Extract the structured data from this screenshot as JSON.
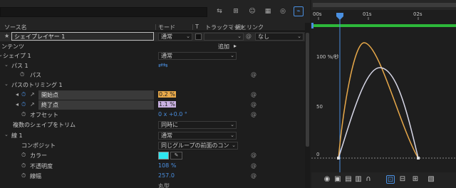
{
  "header": {
    "col_source": "ソース名",
    "col_mode": "モード",
    "col_t": "T",
    "col_trackmatte": "トラックマット",
    "col_parent": "親とリンク"
  },
  "layer": {
    "star": "★",
    "name": "シェイプレイヤー 1",
    "mode": "通常",
    "parent": "なし"
  },
  "rows": {
    "contents": "ンテンツ",
    "add_label": "追加",
    "shape1": "シェイプ 1",
    "shape1_mode": "通常",
    "path1": "パス 1",
    "path": "パス",
    "trim": "パスのトリミング 1",
    "start": "開始点",
    "start_val": "0.2 %",
    "end": "終了点",
    "end_val": "1.1 %",
    "offset": "オフセット",
    "offset_val": "0 x +0.0 °",
    "multi_trim": "複数のシェイプをトリム",
    "multi_trim_val": "同時に",
    "stroke1": "線 1",
    "stroke1_mode": "通常",
    "composite": "コンポジット",
    "composite_val": "同じグループの前面のコン",
    "color": "カラー",
    "opacity": "不透明度",
    "opacity_val": "108 %",
    "width": "線幅",
    "width_val": "257.0",
    "last_val": "丸型"
  },
  "graph": {
    "time_labels": [
      "00s",
      "01s",
      "02s"
    ],
    "y_labels": [
      "100 %/秒",
      "50",
      "0"
    ],
    "curve_colors": {
      "start": "#e8a94a",
      "end": "#d8d8e8"
    }
  },
  "colors": {
    "accent": "#4a8fe0",
    "highlight_start": "#e8a94a",
    "highlight_end": "#c8b0e0",
    "swatch": "#2ee6f0",
    "green": "#2db83a"
  },
  "icons": [
    "composition-flow-icon",
    "layer-switch-icon",
    "motion-blur-icon",
    "frame-blend-icon",
    "graph-editor-icon",
    "eye-icon",
    "snap-icon",
    "magnet-icon"
  ]
}
